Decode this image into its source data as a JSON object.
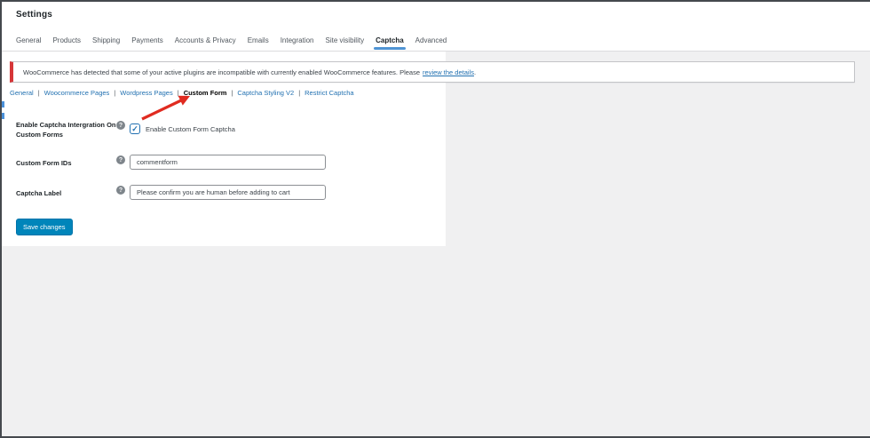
{
  "colors": {
    "accent_blue": "#2271b1",
    "active_tab_underline": "#4f94d4",
    "notice_red_border": "#d63638",
    "arrow_red": "#e02b20",
    "save_button_blue": "#0085ba",
    "page_background": "#f0f0f1",
    "panel_background": "#ffffff"
  },
  "header": {
    "title": "Settings"
  },
  "tabs": {
    "items": [
      {
        "label": "General",
        "active": false
      },
      {
        "label": "Products",
        "active": false
      },
      {
        "label": "Shipping",
        "active": false
      },
      {
        "label": "Payments",
        "active": false
      },
      {
        "label": "Accounts & Privacy",
        "active": false
      },
      {
        "label": "Emails",
        "active": false
      },
      {
        "label": "Integration",
        "active": false
      },
      {
        "label": "Site visibility",
        "active": false
      },
      {
        "label": "Captcha",
        "active": true
      },
      {
        "label": "Advanced",
        "active": false
      }
    ]
  },
  "notice": {
    "text": "WooCommerce has detected that some of your active plugins are incompatible with currently enabled WooCommerce features. Please",
    "link_text": "review the details",
    "suffix": "."
  },
  "subnav": {
    "separator": "|",
    "items": [
      {
        "label": "General",
        "active": false
      },
      {
        "label": "Woocommerce Pages",
        "active": false
      },
      {
        "label": "Wordpress Pages",
        "active": false
      },
      {
        "label": "Custom Form",
        "active": true
      },
      {
        "label": "Captcha Styling V2",
        "active": false
      },
      {
        "label": "Restrict Captcha",
        "active": false
      }
    ]
  },
  "annotation": {
    "type": "red-arrow",
    "points_to": "Custom Form"
  },
  "icons": {
    "help": "?",
    "checkmark": "✓"
  },
  "form": {
    "fields": [
      {
        "label": "Enable Captcha Intergration On Custom Forms",
        "type": "checkbox",
        "checkbox_label": "Enable Custom Form Captcha",
        "checked": true
      },
      {
        "label": "Custom Form IDs",
        "type": "text",
        "value": "commentform"
      },
      {
        "label": "Captcha Label",
        "type": "text",
        "value": "Please confirm you are human before adding to cart"
      }
    ],
    "save_label": "Save changes"
  }
}
